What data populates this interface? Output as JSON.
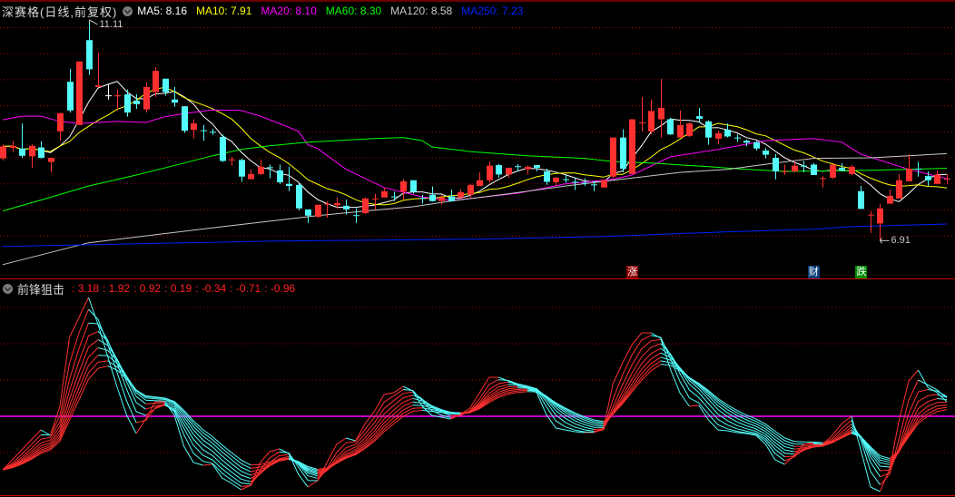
{
  "header": {
    "title": "深赛格(日线,前复权)",
    "ma_legend": [
      {
        "name": "MA5",
        "value": "8.16",
        "color": "#ffffff"
      },
      {
        "name": "MA10",
        "value": "7.91",
        "color": "#ffff00"
      },
      {
        "name": "MA20",
        "value": "8.10",
        "color": "#ff00ff"
      },
      {
        "name": "MA60",
        "value": "8.30",
        "color": "#00ff00"
      },
      {
        "name": "MA120",
        "value": "8.58",
        "color": "#c8c8c8"
      },
      {
        "name": "MA250",
        "value": "7.23",
        "color": "#0022ff"
      }
    ]
  },
  "indicator": {
    "name": "前锋狙击",
    "values": [
      "3.18",
      "1.92",
      "0.92",
      "0.19",
      "-0.34",
      "-0.71",
      "-0.96"
    ]
  },
  "colors": {
    "up": "#ff3030",
    "down": "#54fcfc",
    "flat": "#ffffff",
    "grid": "#a80000",
    "border": "#d00000",
    "zero_line": "#ff00ff"
  },
  "chart_data": [
    {
      "type": "candlestick",
      "title": "深赛格(日线,前复权)",
      "price_axis_range": [
        6.22,
        11.53
      ],
      "gridlines": [
        11.0,
        10.5,
        10.0,
        9.5,
        9.0,
        8.5,
        8.0,
        7.5,
        7.0
      ],
      "ohlc": [
        [
          8.49,
          8.76,
          8.45,
          8.72
        ],
        [
          8.69,
          8.83,
          8.61,
          8.73
        ],
        [
          8.68,
          9.16,
          8.5,
          8.54
        ],
        [
          8.53,
          8.76,
          8.31,
          8.73
        ],
        [
          8.7,
          8.82,
          8.49,
          8.5
        ],
        [
          8.42,
          8.5,
          8.22,
          8.5
        ],
        [
          9.01,
          9.36,
          8.83,
          9.36
        ],
        [
          9.96,
          10.21,
          9.37,
          9.41
        ],
        [
          9.13,
          10.35,
          9.13,
          10.35
        ],
        [
          10.76,
          11.11,
          10.09,
          10.2
        ],
        [
          9.86,
          10.52,
          9.86,
          9.89
        ],
        [
          9.7,
          9.91,
          9.62,
          9.7
        ],
        [
          9.68,
          9.81,
          9.41,
          9.7
        ],
        [
          9.72,
          9.81,
          9.29,
          9.37
        ],
        [
          9.6,
          9.72,
          9.44,
          9.53
        ],
        [
          9.43,
          9.95,
          9.37,
          9.86
        ],
        [
          9.76,
          10.24,
          9.67,
          10.17
        ],
        [
          10.02,
          10.02,
          9.69,
          9.76
        ],
        [
          9.62,
          9.86,
          9.48,
          9.56
        ],
        [
          9.49,
          9.49,
          8.98,
          9.02
        ],
        [
          9.04,
          9.24,
          8.87,
          9.16
        ],
        [
          9.03,
          9.13,
          8.83,
          9.02
        ],
        [
          9.0,
          9.06,
          8.94,
          8.99
        ],
        [
          8.9,
          8.95,
          8.42,
          8.44
        ],
        [
          8.46,
          8.52,
          8.35,
          8.47
        ],
        [
          8.46,
          8.49,
          8.04,
          8.14
        ],
        [
          8.09,
          8.28,
          8.09,
          8.19
        ],
        [
          8.19,
          8.47,
          8.17,
          8.33
        ],
        [
          8.32,
          8.37,
          8.11,
          8.31
        ],
        [
          8.26,
          8.37,
          8.0,
          8.03
        ],
        [
          8.0,
          8.33,
          7.86,
          7.96
        ],
        [
          7.98,
          8.02,
          7.49,
          7.53
        ],
        [
          7.51,
          7.51,
          7.25,
          7.39
        ],
        [
          7.37,
          7.6,
          7.35,
          7.6
        ],
        [
          7.61,
          7.67,
          7.35,
          7.62
        ],
        [
          7.59,
          7.74,
          7.53,
          7.63
        ],
        [
          7.58,
          7.7,
          7.41,
          7.51
        ],
        [
          7.4,
          7.53,
          7.25,
          7.39
        ],
        [
          7.44,
          7.74,
          7.42,
          7.72
        ],
        [
          7.71,
          7.81,
          7.5,
          7.72
        ],
        [
          7.74,
          7.93,
          7.74,
          7.86
        ],
        [
          7.76,
          7.85,
          7.67,
          7.75
        ],
        [
          7.85,
          8.09,
          7.7,
          8.05
        ],
        [
          8.07,
          8.07,
          7.81,
          7.85
        ],
        [
          7.73,
          7.79,
          7.62,
          7.72
        ],
        [
          7.79,
          7.95,
          7.66,
          7.67
        ],
        [
          7.67,
          7.79,
          7.6,
          7.74
        ],
        [
          7.76,
          7.89,
          7.67,
          7.67
        ],
        [
          7.74,
          7.89,
          7.72,
          7.84
        ],
        [
          7.79,
          8.0,
          7.74,
          7.98
        ],
        [
          7.96,
          8.22,
          7.96,
          8.07
        ],
        [
          8.07,
          8.43,
          8.02,
          8.35
        ],
        [
          8.36,
          8.38,
          8.12,
          8.18
        ],
        [
          8.18,
          8.31,
          8.12,
          8.31
        ],
        [
          8.34,
          8.38,
          8.24,
          8.33
        ],
        [
          8.28,
          8.35,
          8.18,
          8.33
        ],
        [
          8.36,
          8.36,
          8.24,
          8.31
        ],
        [
          8.24,
          8.29,
          7.98,
          8.04
        ],
        [
          8.03,
          8.13,
          7.96,
          8.12
        ],
        [
          8.09,
          8.17,
          8.02,
          8.08
        ],
        [
          8.04,
          8.11,
          7.88,
          8.03
        ],
        [
          8.02,
          8.11,
          7.96,
          8.01
        ],
        [
          7.99,
          8.05,
          7.86,
          7.98
        ],
        [
          7.93,
          8.09,
          7.93,
          8.07
        ],
        [
          8.14,
          8.89,
          8.11,
          8.89
        ],
        [
          8.89,
          9.05,
          8.22,
          8.29
        ],
        [
          8.19,
          9.24,
          8.19,
          9.24
        ],
        [
          9.17,
          9.67,
          9.01,
          9.18
        ],
        [
          9.01,
          9.62,
          8.95,
          9.4
        ],
        [
          9.24,
          10.02,
          8.89,
          9.46
        ],
        [
          9.24,
          9.27,
          8.94,
          8.95
        ],
        [
          8.89,
          9.41,
          8.89,
          9.13
        ],
        [
          8.92,
          9.18,
          8.9,
          9.16
        ],
        [
          9.3,
          9.46,
          9.18,
          9.25
        ],
        [
          9.2,
          9.22,
          8.75,
          8.89
        ],
        [
          8.87,
          9.02,
          8.76,
          8.97
        ],
        [
          9.04,
          9.16,
          8.89,
          8.91
        ],
        [
          8.89,
          8.95,
          8.81,
          8.88
        ],
        [
          8.83,
          8.85,
          8.72,
          8.79
        ],
        [
          8.8,
          8.83,
          8.64,
          8.68
        ],
        [
          8.64,
          8.69,
          8.49,
          8.56
        ],
        [
          8.5,
          8.57,
          8.09,
          8.24
        ],
        [
          8.23,
          8.37,
          8.17,
          8.24
        ],
        [
          8.24,
          8.43,
          8.22,
          8.35
        ],
        [
          8.35,
          8.44,
          8.22,
          8.34
        ],
        [
          8.37,
          8.4,
          8.17,
          8.17
        ],
        [
          8.1,
          8.15,
          7.93,
          8.11
        ],
        [
          8.12,
          8.37,
          8.1,
          8.37
        ],
        [
          8.31,
          8.4,
          8.24,
          8.26
        ],
        [
          8.19,
          8.36,
          8.17,
          8.33
        ],
        [
          7.86,
          7.96,
          7.52,
          7.52
        ],
        [
          7.4,
          7.48,
          7.06,
          7.41
        ],
        [
          7.24,
          7.62,
          6.91,
          7.53
        ],
        [
          7.62,
          7.89,
          7.62,
          7.77
        ],
        [
          7.72,
          8.19,
          7.72,
          8.07
        ],
        [
          8.05,
          8.57,
          8.05,
          8.29
        ],
        [
          8.29,
          8.42,
          8.14,
          8.28
        ],
        [
          8.15,
          8.24,
          7.96,
          8.07
        ],
        [
          8.0,
          8.26,
          8.0,
          8.18
        ],
        [
          8.09,
          8.19,
          8.0,
          8.1
        ]
      ],
      "moving_averages": [
        {
          "name": "MA5",
          "period": 5,
          "color": "#ffffff",
          "computed": true
        },
        {
          "name": "MA10",
          "period": 10,
          "color": "#ffff00",
          "computed": true
        },
        {
          "name": "MA20",
          "color": "#ff00ff",
          "points": [
            [
              0,
              9.23
            ],
            [
              2,
              9.3
            ],
            [
              4,
              9.3
            ],
            [
              6,
              9.2
            ],
            [
              8,
              9.16
            ],
            [
              12,
              9.2
            ],
            [
              15,
              9.18
            ],
            [
              17,
              9.29
            ],
            [
              19,
              9.35
            ],
            [
              22,
              9.42
            ],
            [
              25,
              9.41
            ],
            [
              27,
              9.3
            ],
            [
              29,
              9.16
            ],
            [
              31,
              9.01
            ],
            [
              32,
              8.75
            ],
            [
              33,
              8.68
            ],
            [
              36,
              8.28
            ],
            [
              40,
              7.93
            ],
            [
              44,
              7.75
            ],
            [
              47,
              7.68
            ],
            [
              50,
              7.74
            ],
            [
              54,
              7.82
            ],
            [
              59,
              8.0
            ],
            [
              64,
              8.09
            ],
            [
              66,
              8.17
            ],
            [
              70,
              8.52
            ],
            [
              75,
              8.66
            ],
            [
              80,
              8.83
            ],
            [
              85,
              8.87
            ],
            [
              88,
              8.8
            ],
            [
              90,
              8.57
            ],
            [
              95,
              8.28
            ],
            [
              99,
              8.1
            ]
          ]
        },
        {
          "name": "MA60",
          "color": "#00ff00",
          "points": [
            [
              0,
              7.48
            ],
            [
              4,
              7.69
            ],
            [
              9,
              7.96
            ],
            [
              14,
              8.17
            ],
            [
              19,
              8.4
            ],
            [
              22,
              8.54
            ],
            [
              25,
              8.66
            ],
            [
              28,
              8.73
            ],
            [
              32,
              8.8
            ],
            [
              39,
              8.87
            ],
            [
              42,
              8.89
            ],
            [
              44,
              8.83
            ],
            [
              45,
              8.71
            ],
            [
              49,
              8.62
            ],
            [
              55,
              8.54
            ],
            [
              61,
              8.49
            ],
            [
              64,
              8.43
            ],
            [
              68,
              8.4
            ],
            [
              74,
              8.33
            ],
            [
              78,
              8.28
            ],
            [
              82,
              8.24
            ],
            [
              91,
              8.26
            ],
            [
              99,
              8.3
            ]
          ]
        },
        {
          "name": "MA120",
          "color": "#c8c8c8",
          "points": [
            [
              0,
              6.45
            ],
            [
              9,
              6.87
            ],
            [
              19,
              7.09
            ],
            [
              24,
              7.2
            ],
            [
              33,
              7.39
            ],
            [
              38,
              7.48
            ],
            [
              43,
              7.56
            ],
            [
              47,
              7.67
            ],
            [
              53,
              7.81
            ],
            [
              59,
              7.96
            ],
            [
              64,
              8.07
            ],
            [
              71,
              8.22
            ],
            [
              76,
              8.28
            ],
            [
              81,
              8.4
            ],
            [
              85,
              8.49
            ],
            [
              91,
              8.5
            ],
            [
              99,
              8.58
            ]
          ]
        },
        {
          "name": "MA250",
          "color": "#0022ff",
          "points": [
            [
              0,
              6.8
            ],
            [
              28,
              6.9
            ],
            [
              50,
              6.94
            ],
            [
              63,
              6.99
            ],
            [
              66,
              7.01
            ],
            [
              76,
              7.08
            ],
            [
              85,
              7.13
            ],
            [
              89,
              7.18
            ],
            [
              99,
              7.23
            ]
          ]
        }
      ],
      "annotations": {
        "high": {
          "label": "11.11",
          "index": 9,
          "price": 11.11
        },
        "low": {
          "label": "6.91",
          "index": 92,
          "price": 6.91
        }
      },
      "events": [
        {
          "label": "涨",
          "index": 66,
          "color": "#8c0000"
        },
        {
          "label": "财",
          "index": 85,
          "color": "#0a3d78"
        },
        {
          "label": "跌",
          "index": 90,
          "color": "#008c00"
        }
      ]
    },
    {
      "type": "line",
      "title": "前锋狙击",
      "value_axis_range": [
        -17.8,
        29.8
      ],
      "gridlines": [
        24,
        16,
        8,
        -8
      ],
      "zero_line": 0,
      "smoothing_periods": [
        1,
        2,
        3,
        4,
        5,
        6,
        7,
        8,
        9
      ],
      "base_series": [
        -11.8,
        -9.6,
        -7.4,
        -5.2,
        -3.0,
        -4.2,
        2.2,
        17.4,
        21.8,
        26.2,
        20.2,
        13.2,
        6.4,
        0.2,
        -3.8,
        -0.6,
        3.2,
        3.2,
        0.2,
        -6.6,
        -10.2,
        -10.8,
        -10.6,
        -13.6,
        -14.8,
        -16.2,
        -15.2,
        -10.2,
        -7.8,
        -7.2,
        -8.2,
        -12.8,
        -15.6,
        -14.2,
        -10.2,
        -6.2,
        -4.8,
        -5.4,
        -1.6,
        1.2,
        4.8,
        5.2,
        6.6,
        5.6,
        2.2,
        0.2,
        -0.2,
        -0.6,
        0.4,
        1.8,
        5.2,
        8.6,
        8.6,
        7.8,
        6.8,
        6.2,
        5.2,
        0.4,
        -2.6,
        -3.0,
        -3.4,
        -3.6,
        -3.6,
        -2.6,
        7.2,
        11.8,
        15.8,
        18.4,
        18.4,
        17.2,
        10.4,
        5.2,
        2.2,
        2.4,
        -0.8,
        -3.0,
        -3.2,
        -3.6,
        -3.8,
        -4.2,
        -6.2,
        -9.6,
        -10.6,
        -8.6,
        -6.2,
        -5.8,
        -6.2,
        -4.2,
        -1.6,
        0,
        -7.6,
        -15.6,
        -16.6,
        -11.6,
        -0.8,
        7.8,
        10.2,
        6.4,
        5.2,
        3.2
      ]
    }
  ]
}
